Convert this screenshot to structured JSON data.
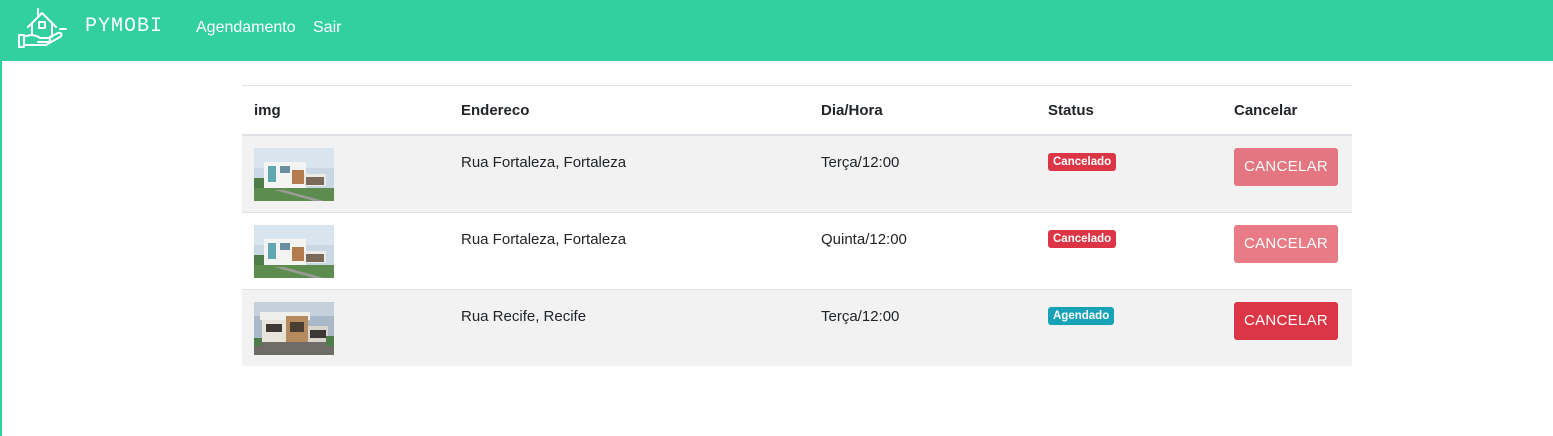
{
  "navbar": {
    "brand": "PYMOBI",
    "logo_icon": "house-in-hand-icon",
    "links": [
      "Agendamento",
      "Sair"
    ],
    "background": "#31d09e"
  },
  "table": {
    "headers": [
      "img",
      "Endereco",
      "Dia/Hora",
      "Status",
      "Cancelar"
    ],
    "rows": [
      {
        "image": "house-photo-modern-white",
        "endereco": "Rua Fortaleza, Fortaleza",
        "dia_hora": "Terça/12:00",
        "status": "Cancelado",
        "status_color": "#dc3545",
        "cancel_label": "CANCELAR",
        "cancel_enabled": false
      },
      {
        "image": "house-photo-modern-white",
        "endereco": "Rua Fortaleza, Fortaleza",
        "dia_hora": "Quinta/12:00",
        "status": "Cancelado",
        "status_color": "#dc3545",
        "cancel_label": "CANCELAR",
        "cancel_enabled": false
      },
      {
        "image": "house-photo-modern-wood",
        "endereco": "Rua Recife, Recife",
        "dia_hora": "Terça/12:00",
        "status": "Agendado",
        "status_color": "#17a2b8",
        "cancel_label": "CANCELAR",
        "cancel_enabled": true
      }
    ]
  }
}
